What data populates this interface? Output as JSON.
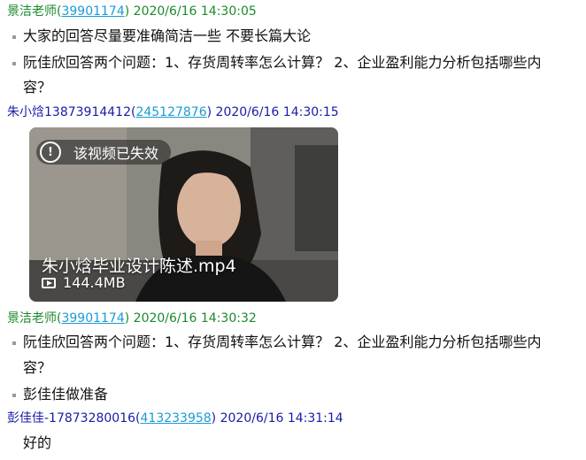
{
  "colors": {
    "teacher_name": "#1b8a2c",
    "student_name": "#1a1aa8",
    "link": "#1a9bd4",
    "bullet": "#9a9a9a"
  },
  "messages": [
    {
      "sender": "景洁老师",
      "id": "39901174",
      "time": "2020/6/16 14:30:05",
      "lines": [
        "大家的回答尽量要准确简洁一些 不要长篇大论",
        "阮佳欣回答两个问题：1、存货周转率怎么计算？ 2、企业盈利能力分析包括哪些内",
        "容？"
      ]
    },
    {
      "sender": "朱小焓13873914412",
      "id": "245127876",
      "time": "2020/6/16 14:30:15",
      "video": {
        "status": "该视频已失效",
        "filename": "朱小焓毕业设计陈述.mp4",
        "size": "144.4MB"
      }
    },
    {
      "sender": "景洁老师",
      "id": "39901174",
      "time": "2020/6/16 14:30:32",
      "lines": [
        "阮佳欣回答两个问题：1、存货周转率怎么计算？ 2、企业盈利能力分析包括哪些内",
        "容？",
        "彭佳佳做准备"
      ]
    },
    {
      "sender": "彭佳佳-17873280016",
      "id": "413233958",
      "time": "2020/6/16 14:31:14",
      "lines": [
        "好的"
      ]
    }
  ]
}
